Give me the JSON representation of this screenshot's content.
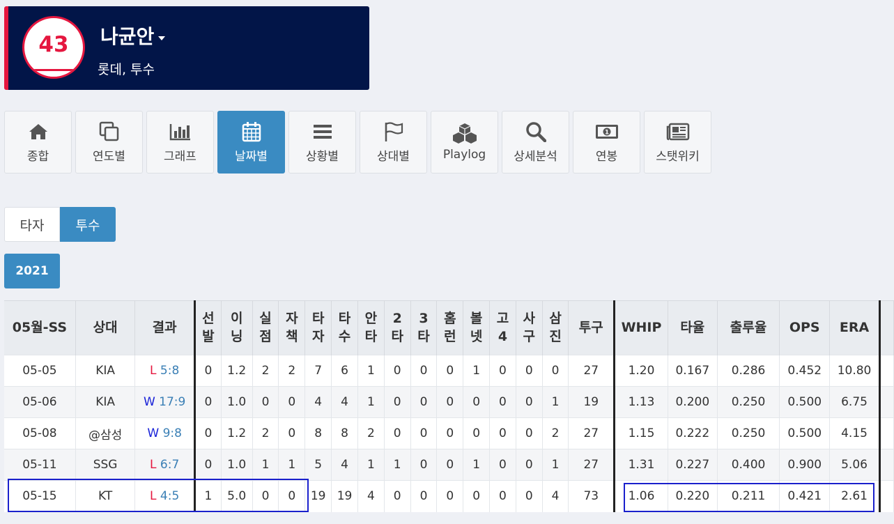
{
  "player": {
    "number": "43",
    "name": "나균안",
    "team_position": "롯데, 투수"
  },
  "nav": [
    {
      "label": "종합",
      "icon": "home-icon",
      "active": false
    },
    {
      "label": "연도별",
      "icon": "copy-icon",
      "active": false
    },
    {
      "label": "그래프",
      "icon": "bar-chart-icon",
      "active": false
    },
    {
      "label": "날짜별",
      "icon": "calendar-icon",
      "active": true
    },
    {
      "label": "상황별",
      "icon": "list-icon",
      "active": false
    },
    {
      "label": "상대별",
      "icon": "flag-icon",
      "active": false
    },
    {
      "label": "Playlog",
      "icon": "cubes-icon",
      "active": false
    },
    {
      "label": "상세분석",
      "icon": "search-icon",
      "active": false
    },
    {
      "label": "연봉",
      "icon": "money-icon",
      "active": false
    },
    {
      "label": "스탯위키",
      "icon": "newspaper-icon",
      "active": false
    }
  ],
  "role_toggle": {
    "batter": "타자",
    "pitcher": "투수",
    "selected": "투수"
  },
  "year": "2021",
  "table": {
    "headers": {
      "date": "05월-SS",
      "opp": "상대",
      "result": "결과",
      "gs": [
        "선",
        "발"
      ],
      "ip": [
        "이",
        "닝"
      ],
      "r": [
        "실",
        "점"
      ],
      "er": [
        "자",
        "책"
      ],
      "tbf": [
        "타",
        "자"
      ],
      "ab": [
        "타",
        "수"
      ],
      "h": [
        "안",
        "타"
      ],
      "d": [
        "2",
        "타"
      ],
      "t": [
        "3",
        "타"
      ],
      "hr": [
        "홈",
        "런"
      ],
      "bb": [
        "볼",
        "넷"
      ],
      "ibb": [
        "고",
        "4"
      ],
      "hbp": [
        "사",
        "구"
      ],
      "so": [
        "삼",
        "진"
      ],
      "np": "투구",
      "whip": "WHIP",
      "avg": "타율",
      "obp": "출루율",
      "ops": "OPS",
      "era": "ERA"
    },
    "rows": [
      {
        "date": "05-05",
        "opp": "KIA",
        "res": "L",
        "score": "5:8",
        "gs": "0",
        "ip": "1.2",
        "r": "2",
        "er": "2",
        "tbf": "7",
        "ab": "6",
        "h": "1",
        "d": "0",
        "t": "0",
        "hr": "0",
        "bb": "1",
        "ibb": "0",
        "hbp": "0",
        "so": "0",
        "np": "27",
        "whip": "1.20",
        "avg": "0.167",
        "obp": "0.286",
        "ops": "0.452",
        "era": "10.80"
      },
      {
        "date": "05-06",
        "opp": "KIA",
        "res": "W",
        "score": "17:9",
        "gs": "0",
        "ip": "1.0",
        "r": "0",
        "er": "0",
        "tbf": "4",
        "ab": "4",
        "h": "1",
        "d": "0",
        "t": "0",
        "hr": "0",
        "bb": "0",
        "ibb": "0",
        "hbp": "0",
        "so": "1",
        "np": "19",
        "whip": "1.13",
        "avg": "0.200",
        "obp": "0.250",
        "ops": "0.500",
        "era": "6.75"
      },
      {
        "date": "05-08",
        "opp": "@삼성",
        "res": "W",
        "score": "9:8",
        "gs": "0",
        "ip": "1.2",
        "r": "2",
        "er": "0",
        "tbf": "8",
        "ab": "8",
        "h": "2",
        "d": "0",
        "t": "0",
        "hr": "0",
        "bb": "0",
        "ibb": "0",
        "hbp": "0",
        "so": "2",
        "np": "27",
        "whip": "1.15",
        "avg": "0.222",
        "obp": "0.250",
        "ops": "0.500",
        "era": "4.15"
      },
      {
        "date": "05-11",
        "opp": "SSG",
        "res": "L",
        "score": "6:7",
        "gs": "0",
        "ip": "1.0",
        "r": "1",
        "er": "1",
        "tbf": "5",
        "ab": "4",
        "h": "1",
        "d": "1",
        "t": "0",
        "hr": "0",
        "bb": "1",
        "ibb": "0",
        "hbp": "0",
        "so": "1",
        "np": "27",
        "whip": "1.31",
        "avg": "0.227",
        "obp": "0.400",
        "ops": "0.900",
        "era": "5.06"
      },
      {
        "date": "05-15",
        "opp": "KT",
        "res": "L",
        "score": "4:5",
        "gs": "1",
        "ip": "5.0",
        "r": "0",
        "er": "0",
        "tbf": "19",
        "ab": "19",
        "h": "4",
        "d": "0",
        "t": "0",
        "hr": "0",
        "bb": "0",
        "ibb": "0",
        "hbp": "0",
        "so": "4",
        "np": "73",
        "whip": "1.06",
        "avg": "0.220",
        "obp": "0.211",
        "ops": "0.421",
        "era": "2.61"
      }
    ]
  }
}
